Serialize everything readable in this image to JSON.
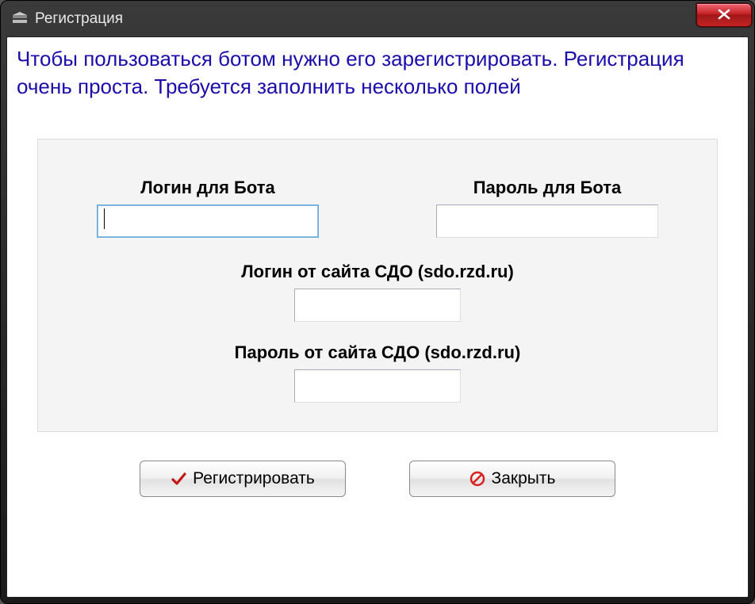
{
  "window": {
    "title": "Регистрация",
    "close_icon": "x"
  },
  "instruction": "Чтобы пользоваться ботом нужно его зарегистрировать. Регистрация очень проста. Требуется заполнить несколько полей",
  "form": {
    "bot_login": {
      "label": "Логин для Бота",
      "value": ""
    },
    "bot_password": {
      "label": "Пароль для Бота",
      "value": ""
    },
    "sdo_login": {
      "label": "Логин от сайта СДО (sdo.rzd.ru)",
      "value": ""
    },
    "sdo_password": {
      "label": "Пароль от сайта СДО (sdo.rzd.ru)",
      "value": ""
    }
  },
  "buttons": {
    "register": "Регистрировать",
    "close": "Закрыть"
  },
  "icons": {
    "check": "check-icon",
    "forbid": "forbid-icon"
  }
}
